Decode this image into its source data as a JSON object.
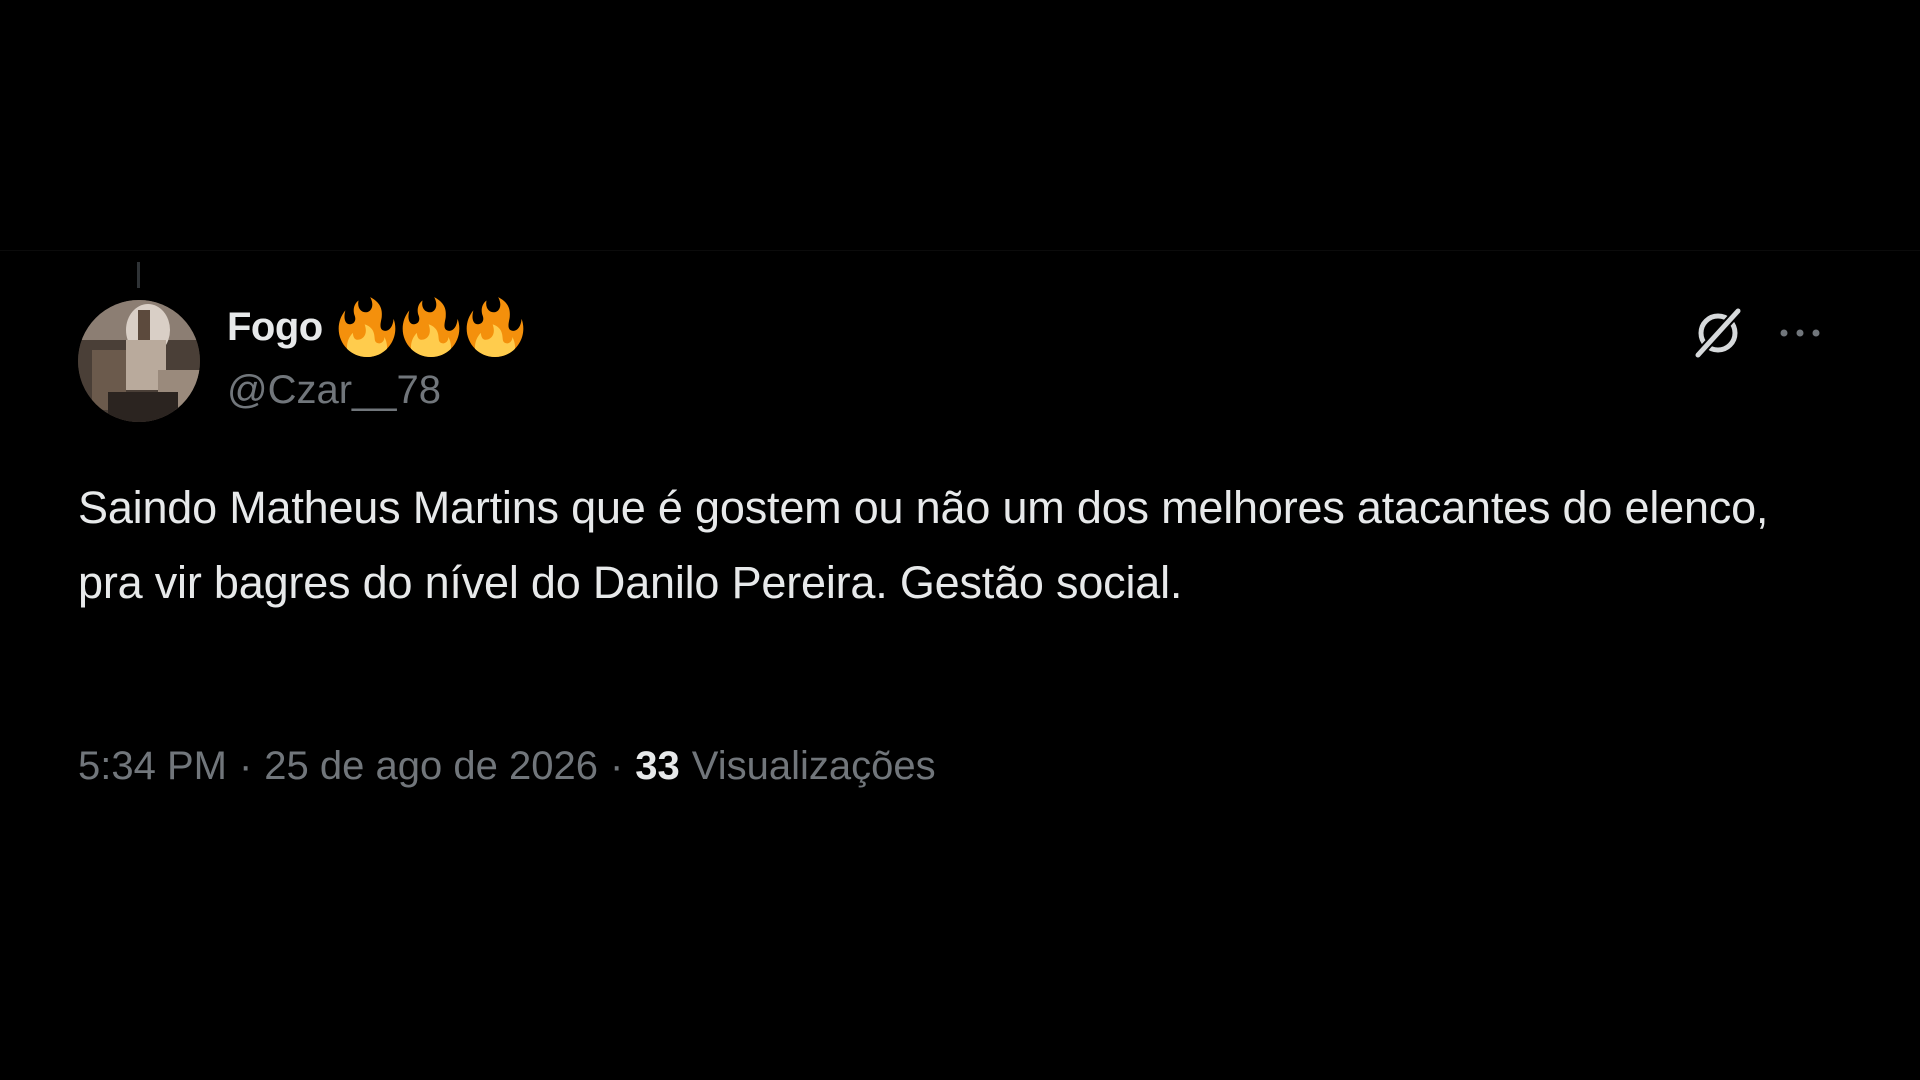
{
  "author": {
    "display_name": "Fogo",
    "handle": "@Czar__78",
    "name_emojis": [
      "fire",
      "fire",
      "fire"
    ],
    "avatar_icon": "profile-photo"
  },
  "tweet": {
    "text": "Saindo Matheus Martins que é gostem ou não um dos melhores atacantes do elenco, pra vir bagres do nível do Danilo Pereira. Gestão social."
  },
  "meta": {
    "time": "5:34 PM",
    "separator": "·",
    "date": "25 de ago de 2026",
    "views_count": "33",
    "views_label": "Visualizações"
  },
  "icons": {
    "grok": "grok-icon",
    "more": "more-icon",
    "fire": "fire-icon"
  },
  "colors": {
    "background": "#000000",
    "primary_text": "#e7e9ea",
    "secondary_text": "#71767b",
    "flame_outer": "#f4900c",
    "flame_inner": "#ffcc4d"
  }
}
